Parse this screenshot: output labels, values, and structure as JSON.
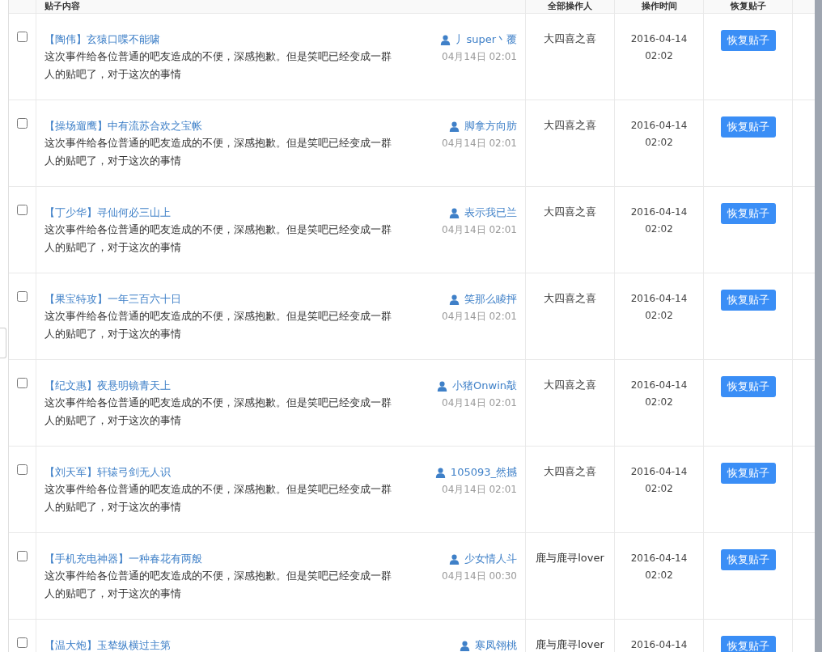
{
  "table": {
    "columns": [
      "贴子内容",
      "全部操作人",
      "操作时间",
      "恢复贴子"
    ],
    "rows": [
      {
        "checked": false,
        "title": "【陶伟】玄猿口喋不能啸",
        "text": "这次事件给各位普通的吧友造成的不便，深感抱歉。但是笑吧已经变成一群人的贴吧了，对于这次的事情",
        "author": "丿super丶覆",
        "posted": "04月14日 02:01",
        "operator": "大四喜之喜",
        "date": "2016-04-14",
        "time": "02:02",
        "action": "恢复贴子"
      },
      {
        "checked": false,
        "title": "【操场遛鹰】中有流苏合欢之宝帐",
        "text": "这次事件给各位普通的吧友造成的不便，深感抱歉。但是笑吧已经变成一群人的贴吧了，对于这次的事情",
        "author": "脚拿方向肪",
        "posted": "04月14日 02:01",
        "operator": "大四喜之喜",
        "date": "2016-04-14",
        "time": "02:02",
        "action": "恢复贴子"
      },
      {
        "checked": false,
        "title": "【丁少华】寻仙何必三山上",
        "text": "这次事件给各位普通的吧友造成的不便，深感抱歉。但是笑吧已经变成一群人的贴吧了，对于这次的事情",
        "author": "表示我已兰",
        "posted": "04月14日 02:01",
        "operator": "大四喜之喜",
        "date": "2016-04-14",
        "time": "02:02",
        "action": "恢复贴子"
      },
      {
        "checked": false,
        "title": "【果宝特攻】一年三百六十日",
        "text": "这次事件给各位普通的吧友造成的不便，深感抱歉。但是笑吧已经变成一群人的贴吧了，对于这次的事情",
        "author": "笑那么睖抨",
        "posted": "04月14日 02:01",
        "operator": "大四喜之喜",
        "date": "2016-04-14",
        "time": "02:02",
        "action": "恢复贴子"
      },
      {
        "checked": false,
        "title": "【纪文惠】夜悬明镜青天上",
        "text": "这次事件给各位普通的吧友造成的不便，深感抱歉。但是笑吧已经变成一群人的贴吧了，对于这次的事情",
        "author": "小猪Onwin敲",
        "posted": "04月14日 02:01",
        "operator": "大四喜之喜",
        "date": "2016-04-14",
        "time": "02:02",
        "action": "恢复贴子"
      },
      {
        "checked": false,
        "title": "【刘天军】轩辕弓剑无人识",
        "text": "这次事件给各位普通的吧友造成的不便，深感抱歉。但是笑吧已经变成一群人的贴吧了，对于这次的事情",
        "author": "105093_然撼",
        "posted": "04月14日 02:01",
        "operator": "大四喜之喜",
        "date": "2016-04-14",
        "time": "02:02",
        "action": "恢复贴子"
      },
      {
        "checked": false,
        "title": "【手机充电神器】一种春花有两般",
        "text": "这次事件给各位普通的吧友造成的不便，深感抱歉。但是笑吧已经变成一群人的贴吧了，对于这次的事情",
        "author": "少女情人斗",
        "posted": "04月14日 00:30",
        "operator": "鹿与鹿寻lover",
        "date": "2016-04-14",
        "time": "02:02",
        "action": "恢复贴子"
      },
      {
        "checked": false,
        "title": "【温大炮】玉辇纵横过主第",
        "author": "寒凤翎桃",
        "operator": "鹿与鹿寻lover",
        "date": "2016-04-14",
        "action": "恢复贴子"
      }
    ]
  }
}
